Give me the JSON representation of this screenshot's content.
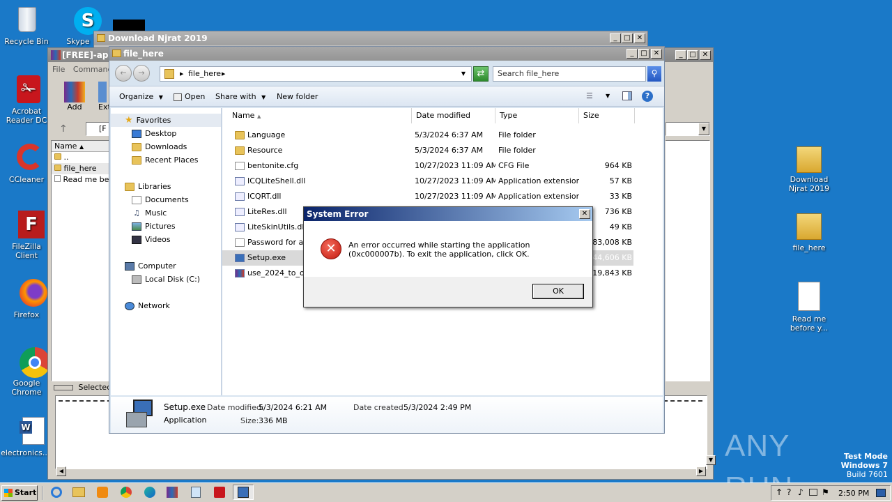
{
  "desktop_icons_left": [
    {
      "label": "Recycle Bin",
      "icon": "recycle-bin-icon"
    },
    {
      "label": "Acrobat Reader DC",
      "icon": "acrobat-icon"
    },
    {
      "label": "CCleaner",
      "icon": "ccleaner-icon"
    },
    {
      "label": "FileZilla Client",
      "icon": "filezilla-icon"
    },
    {
      "label": "Firefox",
      "icon": "firefox-icon"
    },
    {
      "label": "Google Chrome",
      "icon": "chrome-icon"
    },
    {
      "label": "electronics....",
      "icon": "word-doc-icon"
    }
  ],
  "desktop_icon_skype": "Skype",
  "desktop_icons_right": [
    {
      "label": "Download Njrat 2019",
      "icon": "folder-icon"
    },
    {
      "label": "file_here",
      "icon": "folder-icon"
    },
    {
      "label": "Read me before y...",
      "icon": "text-file-icon"
    }
  ],
  "back_window": {
    "title": "Download Njrat 2019"
  },
  "winrar_window": {
    "title": "[FREE]-app_",
    "menu": [
      "File",
      "Commands"
    ],
    "toolbar": {
      "add": "Add",
      "extract": "Ext"
    },
    "path_fragment": "[F",
    "column_name": "Name",
    "items": [
      "..",
      "file_here",
      "Read me bef"
    ],
    "status": "Selected"
  },
  "explorer": {
    "title": "file_here",
    "breadcrumb": "file_here",
    "search_placeholder": "Search file_here",
    "commands": {
      "organize": "Organize",
      "open": "Open",
      "share": "Share with",
      "new_folder": "New folder"
    },
    "nav": {
      "favorites": "Favorites",
      "favorites_items": [
        "Desktop",
        "Downloads",
        "Recent Places"
      ],
      "libraries": "Libraries",
      "libraries_items": [
        "Documents",
        "Music",
        "Pictures",
        "Videos"
      ],
      "computer": "Computer",
      "computer_items": [
        "Local Disk (C:)"
      ],
      "network": "Network"
    },
    "columns": [
      "Name",
      "Date modified",
      "Type",
      "Size"
    ],
    "files": [
      {
        "name": "Language",
        "date": "5/3/2024 6:37 AM",
        "type": "File folder",
        "size": "",
        "kind": "folder"
      },
      {
        "name": "Resource",
        "date": "5/3/2024 6:37 AM",
        "type": "File folder",
        "size": "",
        "kind": "folder"
      },
      {
        "name": "bentonite.cfg",
        "date": "10/27/2023 11:09 AM",
        "type": "CFG File",
        "size": "964 KB",
        "kind": "doc"
      },
      {
        "name": "ICQLiteShell.dll",
        "date": "10/27/2023 11:09 AM",
        "type": "Application extension",
        "size": "57 KB",
        "kind": "dll"
      },
      {
        "name": "ICQRT.dll",
        "date": "10/27/2023 11:09 AM",
        "type": "Application extension",
        "size": "33 KB",
        "kind": "dll"
      },
      {
        "name": "LiteRes.dll",
        "date": "",
        "type": "",
        "size": "736 KB",
        "kind": "dll"
      },
      {
        "name": "LiteSkinUtils.dll",
        "date": "",
        "type": "",
        "size": "49 KB",
        "kind": "dll"
      },
      {
        "name": "Password for arc",
        "date": "",
        "type": "",
        "size": "183,008 KB",
        "kind": "doc"
      },
      {
        "name": "Setup.exe",
        "date": "",
        "type": "",
        "size": "344,606 KB",
        "kind": "exe"
      },
      {
        "name": "use_2024_to_op",
        "date": "",
        "type": "",
        "size": "19,843 KB",
        "kind": "rar"
      }
    ],
    "details": {
      "name": "Setup.exe",
      "kind": "Application",
      "date_modified_label": "Date modified:",
      "date_modified": "5/3/2024 6:21 AM",
      "date_created_label": "Date created:",
      "date_created": "5/3/2024 2:49 PM",
      "size_label": "Size:",
      "size": "336 MB"
    }
  },
  "dialog": {
    "title": "System Error",
    "message": "An error occurred while starting the application (0xc000007b). To exit the application, click OK.",
    "ok": "OK"
  },
  "taskbar": {
    "start": "Start",
    "time": "2:50 PM",
    "apps": [
      "ie-icon",
      "explorer-icon",
      "media-player-icon",
      "chrome-icon",
      "edge-icon",
      "winrar-icon",
      "notepad-icon",
      "acrobat-icon",
      "setup-icon"
    ]
  },
  "watermark": {
    "brand": "ANY RUN",
    "line1": "Test Mode",
    "line2": "Windows 7",
    "line3": "Build 7601"
  }
}
